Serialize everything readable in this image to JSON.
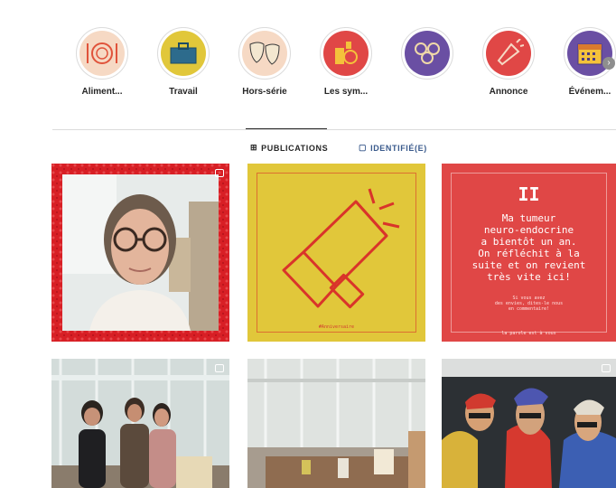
{
  "highlights": [
    {
      "label": "Aliment...",
      "emoji": "🍽",
      "bg": "#f6d9c4",
      "icon": "plate-icon"
    },
    {
      "label": "Travail",
      "emoji": "💼",
      "bg": "#e1c73a",
      "icon": "briefcase-icon"
    },
    {
      "label": "Hors-série",
      "emoji": "🎭",
      "bg": "#f6d9c4",
      "icon": "theater-masks-icon"
    },
    {
      "label": "Les sym...",
      "emoji": "🧪",
      "bg": "#e04746",
      "icon": "lab-flask-icon"
    },
    {
      "label": "",
      "emoji": "👥",
      "bg": "#6a4fa3",
      "icon": "people-icon"
    },
    {
      "label": "Annonce",
      "emoji": "📣",
      "bg": "#e04746",
      "icon": "megaphone-icon"
    },
    {
      "label": "Événem...",
      "emoji": "📅",
      "bg": "#6a4fa3",
      "icon": "calendar-icon"
    }
  ],
  "tabs": {
    "publications": "PUBLICATIONS",
    "tagged": "IDENTIFIÉ(E)"
  },
  "posts": {
    "p2_caption": "#Anniversaire",
    "p3_pause": "II",
    "p3_big": [
      "Ma tumeur",
      "neuro-endocrine",
      "a bientôt un an.",
      "On réfléchit à la",
      "suite et on revient",
      "très vite ici!"
    ],
    "p3_small": [
      "Si vous avez",
      "des envies, dites-le nous",
      "en commentaire!"
    ],
    "p3_footer": "la parole est à vous"
  },
  "colors": {
    "red": "#d81f25",
    "yellow": "#e1c73a",
    "coral": "#e04746",
    "purple": "#6a4fa3"
  }
}
